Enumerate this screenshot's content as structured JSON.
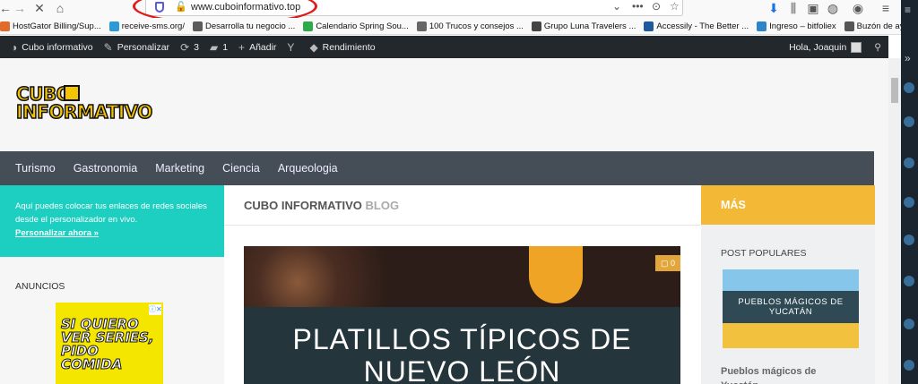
{
  "browser": {
    "url": "www.cuboinformativo.top",
    "bookmarks": [
      {
        "label": "HostGator Billing/Sup...",
        "color": "#e06b2b"
      },
      {
        "label": "receive-sms.org/",
        "color": "#2b9ad6"
      },
      {
        "label": "Desarrolla tu negocio ...",
        "color": "#5b5b5b"
      },
      {
        "label": "Calendario Spring Sou...",
        "color": "#2eaa4b"
      },
      {
        "label": "100 Trucos y consejos ...",
        "color": "#666666"
      },
      {
        "label": "Grupo Luna Travelers ...",
        "color": "#444444"
      },
      {
        "label": "Accessily - The Better ...",
        "color": "#1e5b9c"
      },
      {
        "label": "Ingreso – bitfoliex",
        "color": "#2e84c9"
      },
      {
        "label": "Buzón de ayuda",
        "color": "#555555"
      }
    ],
    "overflow_icon": "»"
  },
  "adminbar": {
    "site_name": "Cubo informativo",
    "customize": "Personalizar",
    "updates_count": "3",
    "comments_count": "1",
    "add_new": "Añadir",
    "performance": "Rendimiento",
    "greeting": "Hola, Joaquin"
  },
  "header": {
    "logo_line1": "CUBO",
    "logo_line2": "INFORMATIVO"
  },
  "menu": [
    "Turismo",
    "Gastronomia",
    "Marketing",
    "Ciencia",
    "Arqueologia"
  ],
  "left": {
    "promo_text": "Aquí puedes colocar tus enlaces de redes sociales desde el personalizador en vivo.",
    "promo_link": "Personalizar ahora »",
    "ads_title": "ANUNCIOS",
    "ad_text": "SI QUIERO VER SERIES, PIDO COMIDA"
  },
  "center": {
    "heading_bold": "CUBO INFORMATIVO",
    "heading_muted": "BLOG",
    "comment_count": "0",
    "feature_title": "PLATILLOS TÍPICOS DE NUEVO LEÓN"
  },
  "right": {
    "mas_label": "MÁS",
    "popular_title": "POST POPULARES",
    "thumb_title": "PUEBLOS MÁGICOS DE YUCATÁN",
    "post_link": "Pueblos mágicos de Yucatán"
  },
  "colors": {
    "admin_bar": "#23282d",
    "menu_bar": "#454d57",
    "promo": "#1ccfc0",
    "mas": "#f2b836",
    "url_annotation": "#e01b1b"
  }
}
